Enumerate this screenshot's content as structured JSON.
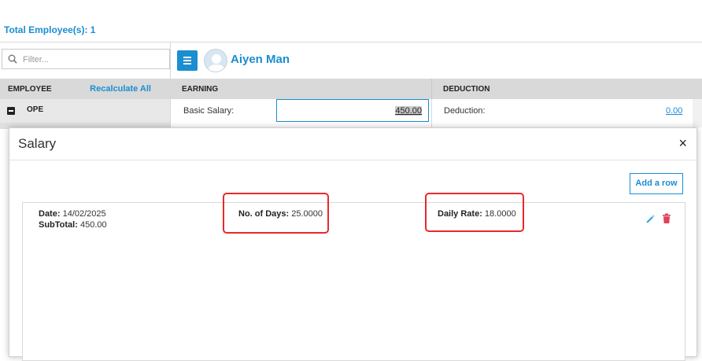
{
  "summary": {
    "total_employees": "Total Employee(s): 1"
  },
  "filter": {
    "placeholder": "Filter..."
  },
  "employee_list": {
    "header_label": "EMPLOYEE",
    "recalculate_label": "Recalculate All",
    "group_label": "OPE"
  },
  "employee": {
    "name": "Aiyen Man"
  },
  "earning": {
    "header": "EARNING",
    "basic_salary_label": "Basic Salary:",
    "basic_salary_value": "450.00"
  },
  "deduction": {
    "header": "DEDUCTION",
    "label": "Deduction:",
    "value": "0.00"
  },
  "modal": {
    "title": "Salary",
    "close": "×",
    "add_row_label": "Add a row",
    "entry": {
      "date_label": "Date:",
      "date_value": "14/02/2025",
      "subtotal_label": "SubTotal:",
      "subtotal_value": "450.00",
      "days_label": "No. of Days:",
      "days_value": "25.0000",
      "rate_label": "Daily Rate:",
      "rate_value": "18.0000"
    }
  },
  "colors": {
    "accent": "#1a8ed0",
    "highlight": "#e8292b",
    "delete": "#e0405a",
    "header_bg": "#d9d9d9"
  }
}
